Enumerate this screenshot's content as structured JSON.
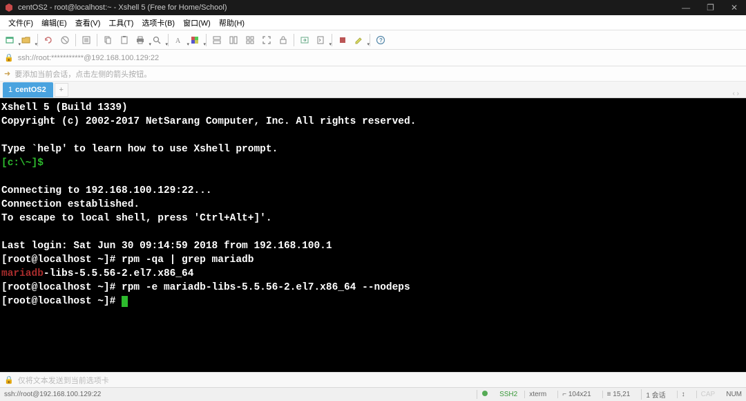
{
  "titlebar": {
    "text": "centOS2 - root@localhost:~ - Xshell 5 (Free for Home/School)"
  },
  "menubar": {
    "file": "文件(F)",
    "edit": "编辑(E)",
    "view": "查看(V)",
    "tools": "工具(T)",
    "tabs": "选项卡(B)",
    "window": "窗口(W)",
    "help": "帮助(H)"
  },
  "addrbar": {
    "text": "ssh://root:***********@192.168.100.129:22"
  },
  "hintbar": {
    "text": "要添加当前会话，点击左侧的箭头按钮。"
  },
  "tabs": {
    "active": {
      "index": "1",
      "label": "centOS2"
    },
    "arrows": "‹ ›"
  },
  "terminal": {
    "line1": "Xshell 5 (Build 1339)",
    "line2": "Copyright (c) 2002-2017 NetSarang Computer, Inc. All rights reserved.",
    "blank1": "",
    "line3": "Type `help' to learn how to use Xshell prompt.",
    "prompt_local": "[c:\\~]$",
    "blank2": "",
    "connecting": "Connecting to 192.168.100.129:22...",
    "connected": "Connection established.",
    "escape": "To escape to local shell, press 'Ctrl+Alt+]'.",
    "blank3": "",
    "lastlogin": "Last login: Sat Jun 30 09:14:59 2018 from 192.168.100.1",
    "prompt1": "[root@localhost ~]# ",
    "cmd1": "rpm -qa | grep mariadb",
    "pkg_red": "mariadb",
    "pkg_rest": "-libs-5.5.56-2.el7.x86_64",
    "prompt2": "[root@localhost ~]# ",
    "cmd2": "rpm -e mariadb-libs-5.5.56-2.el7.x86_64 --nodeps",
    "prompt3": "[root@localhost ~]# "
  },
  "bottombar": {
    "text": "仅将文本发送到当前选项卡"
  },
  "statusbar": {
    "left": "ssh://root@192.168.100.129:22",
    "ssh": "SSH2",
    "term": "xterm",
    "size": "104x21",
    "pos": "15,21",
    "sessions": "1 会话",
    "cap": "CAP",
    "num": "NUM"
  }
}
